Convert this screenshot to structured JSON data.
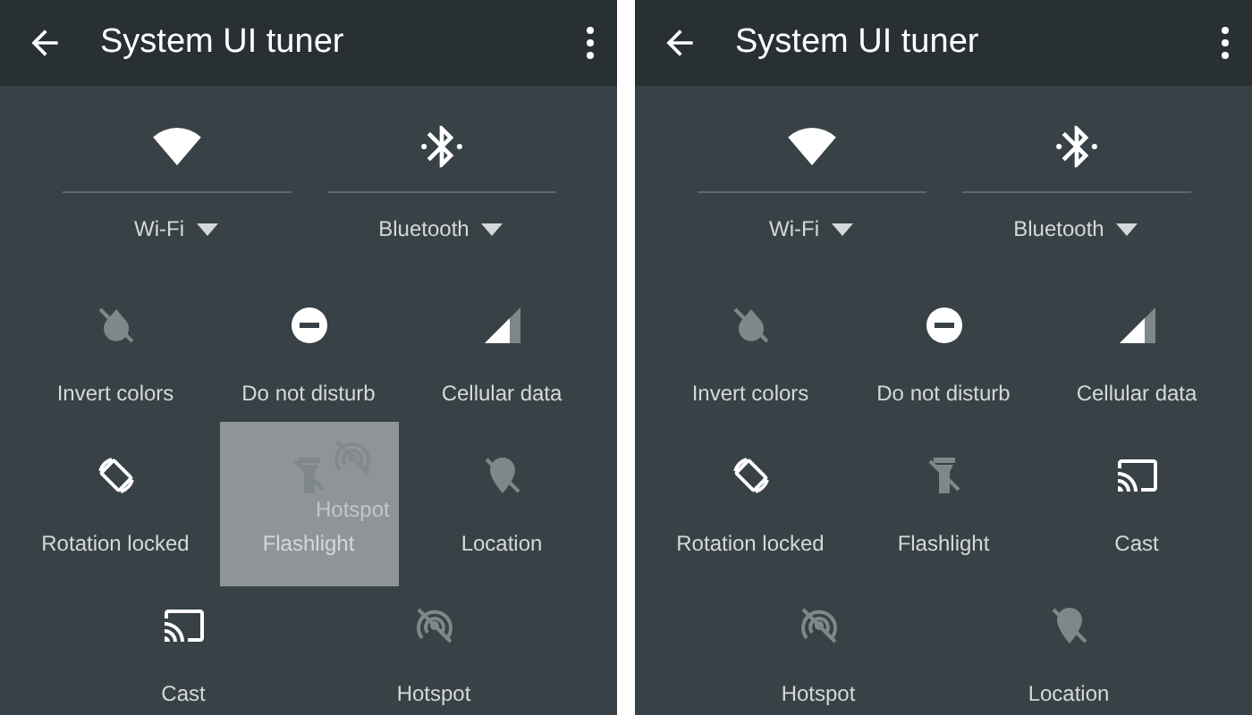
{
  "screens": [
    {
      "title": "System UI tuner",
      "big_tiles": [
        {
          "kind": "wifi",
          "label": "Wi-Fi",
          "on": true
        },
        {
          "kind": "bluetooth",
          "label": "Bluetooth",
          "on": true
        }
      ],
      "tile_rows": [
        [
          {
            "kind": "invert",
            "label": "Invert colors",
            "on": false,
            "highlighted": false
          },
          {
            "kind": "dnd",
            "label": "Do not disturb",
            "on": true,
            "highlighted": false
          },
          {
            "kind": "cellular",
            "label": "Cellular data",
            "on": true,
            "highlighted": false
          }
        ],
        [
          {
            "kind": "rotation",
            "label": "Rotation locked",
            "on": true,
            "highlighted": false
          },
          {
            "kind": "flashlight",
            "label": "Flashlight",
            "on": false,
            "highlighted": true
          },
          {
            "kind": "location",
            "label": "Location",
            "on": false,
            "highlighted": false
          }
        ],
        [
          {
            "kind": "cast",
            "label": "Cast",
            "on": true,
            "highlighted": false
          },
          {
            "kind": "hotspot",
            "label": "Hotspot",
            "on": false,
            "highlighted": false
          }
        ]
      ],
      "drag_ghost": {
        "kind": "hotspot",
        "label": "Hotspot"
      }
    },
    {
      "title": "System UI tuner",
      "big_tiles": [
        {
          "kind": "wifi",
          "label": "Wi-Fi",
          "on": true
        },
        {
          "kind": "bluetooth",
          "label": "Bluetooth",
          "on": true
        }
      ],
      "tile_rows": [
        [
          {
            "kind": "invert",
            "label": "Invert colors",
            "on": false,
            "highlighted": false
          },
          {
            "kind": "dnd",
            "label": "Do not disturb",
            "on": true,
            "highlighted": false
          },
          {
            "kind": "cellular",
            "label": "Cellular data",
            "on": true,
            "highlighted": false
          }
        ],
        [
          {
            "kind": "rotation",
            "label": "Rotation locked",
            "on": true,
            "highlighted": false
          },
          {
            "kind": "flashlight",
            "label": "Flashlight",
            "on": false,
            "highlighted": false
          },
          {
            "kind": "cast",
            "label": "Cast",
            "on": true,
            "highlighted": false
          }
        ],
        [
          {
            "kind": "hotspot",
            "label": "Hotspot",
            "on": false,
            "highlighted": false
          },
          {
            "kind": "location",
            "label": "Location",
            "on": false,
            "highlighted": false
          }
        ]
      ]
    }
  ]
}
